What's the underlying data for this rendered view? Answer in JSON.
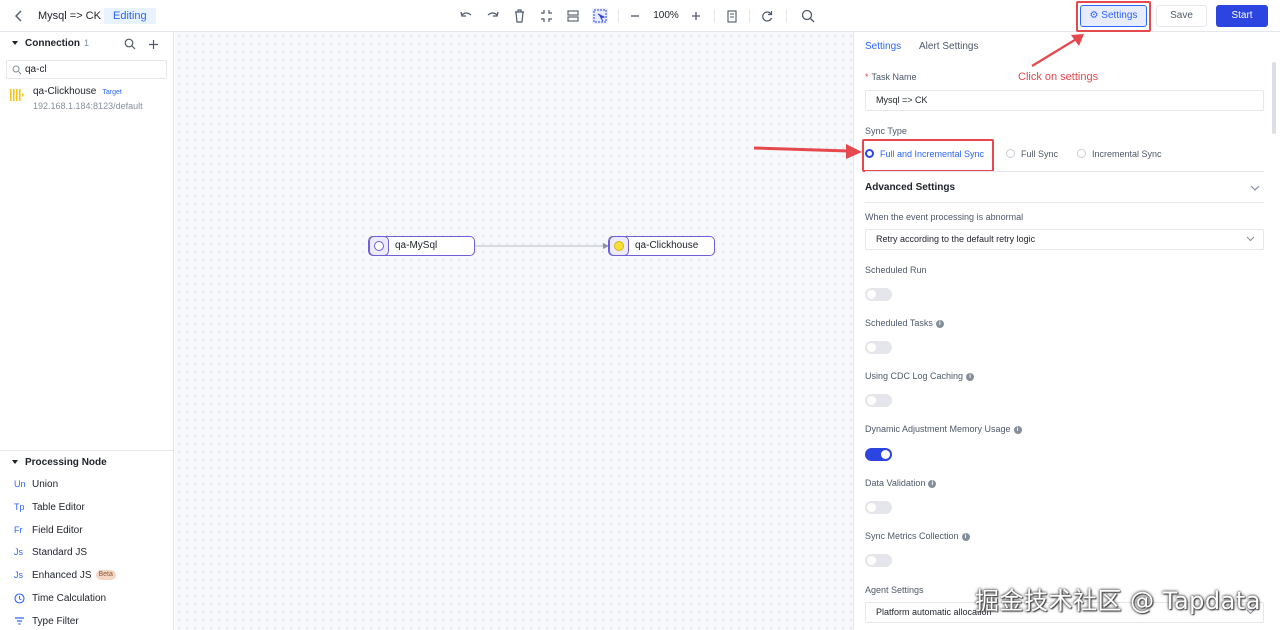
{
  "header": {
    "title": "Mysql => CK",
    "status_badge": "Editing",
    "zoom": "100%",
    "settings_label": "Settings",
    "save_label": "Save",
    "start_label": "Start"
  },
  "sidebar": {
    "connection_title": "Connection",
    "connection_count": "1",
    "search_value": "qa-cl",
    "connections": [
      {
        "name": "qa-Clickhouse",
        "tag": "Target",
        "address": "192.168.1.184:8123/default"
      }
    ],
    "processing_title": "Processing Node",
    "processing_items": [
      {
        "abbr": "Un",
        "label": "Union"
      },
      {
        "abbr": "Tp",
        "label": "Table Editor"
      },
      {
        "abbr": "Fr",
        "label": "Field Editor"
      },
      {
        "abbr": "Js",
        "label": "Standard JS"
      },
      {
        "abbr": "Js",
        "label": "Enhanced JS",
        "badge": "Beta"
      },
      {
        "abbr": "clock",
        "label": "Time Calculation"
      },
      {
        "abbr": "filter",
        "label": "Type Filter"
      }
    ]
  },
  "canvas": {
    "source_node": "qa-MySql",
    "target_node": "qa-Clickhouse"
  },
  "panel": {
    "tabs": [
      "Settings",
      "Alert Settings"
    ],
    "task_name_label": "Task Name",
    "task_name_value": "Mysql => CK",
    "sync_type_label": "Sync Type",
    "sync_options": [
      "Full and Incremental Sync",
      "Full Sync",
      "Incremental Sync"
    ],
    "advanced_title": "Advanced Settings",
    "abnormal_label": "When the event processing is abnormal",
    "abnormal_value": "Retry according to the default retry logic",
    "scheduled_run_label": "Scheduled Run",
    "scheduled_tasks_label": "Scheduled Tasks",
    "cdc_log_label": "Using CDC Log Caching",
    "memory_label": "Dynamic Adjustment Memory Usage",
    "validation_label": "Data Validation",
    "metrics_label": "Sync Metrics Collection",
    "agent_label": "Agent Settings",
    "agent_value": "Platform automatic allocation",
    "toggles": {
      "scheduled_run": false,
      "scheduled_tasks": false,
      "cdc_log": false,
      "memory": true,
      "validation": false,
      "metrics": false
    }
  },
  "annotations": {
    "settings_hint": "Click on settings"
  },
  "watermark": "掘金技术社区 @ Tapdata",
  "colors": {
    "accent": "#2c44e0",
    "annotation": "#e5484d"
  }
}
